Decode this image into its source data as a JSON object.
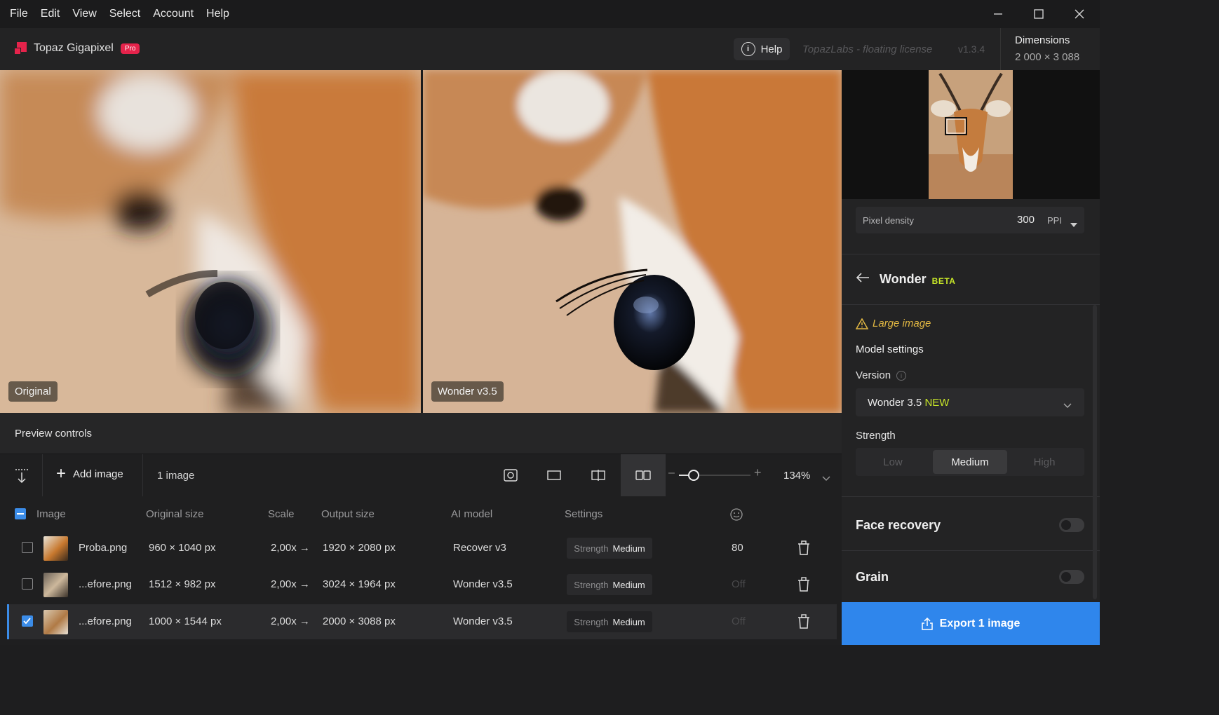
{
  "menu": [
    "File",
    "Edit",
    "View",
    "Select",
    "Account",
    "Help"
  ],
  "app": {
    "name": "Topaz Gigapixel",
    "badge": "Pro",
    "help_label": "Help",
    "license": "TopazLabs - floating license",
    "version": "v1.3.4"
  },
  "dimensions": {
    "label": "Dimensions",
    "value": "2 000 × 3 088"
  },
  "preview": {
    "left_tag": "Original",
    "right_tag": "Wonder v3.5",
    "controls_label": "Preview controls"
  },
  "toolbar": {
    "add_image": "Add image",
    "image_count": "1 image",
    "zoom": "134%",
    "zoom_level": 0.2
  },
  "table": {
    "headers": {
      "image": "Image",
      "original": "Original size",
      "scale": "Scale",
      "output": "Output size",
      "model": "AI model",
      "settings": "Settings"
    },
    "rows": [
      {
        "name": "Proba.png",
        "original": "960 × 1040 px",
        "scale": "2,00x →",
        "output": "1920 × 2080 px",
        "model": "Recover v3",
        "strength_key": "Strength",
        "strength": "Medium",
        "face": "80",
        "checked": false
      },
      {
        "name": "...efore.png",
        "original": "1512 × 982 px",
        "scale": "2,00x →",
        "output": "3024 × 1964 px",
        "model": "Wonder v3.5",
        "strength_key": "Strength",
        "strength": "Medium",
        "face": "Off",
        "checked": false
      },
      {
        "name": "...efore.png",
        "original": "1000 × 1544 px",
        "scale": "2,00x →",
        "output": "2000 × 3088 px",
        "model": "Wonder v3.5",
        "strength_key": "Strength",
        "strength": "Medium",
        "face": "Off",
        "checked": true
      }
    ]
  },
  "sidebar": {
    "pixel_density": {
      "label": "Pixel density",
      "value": "300",
      "unit": "PPI"
    },
    "model_title": "Wonder",
    "model_badge": "BETA",
    "warning": "Large image",
    "model_settings": "Model settings",
    "version_label": "Version",
    "version_value": "Wonder 3.5",
    "version_new": "NEW",
    "strength_label": "Strength",
    "strength_options": [
      "Low",
      "Medium",
      "High"
    ],
    "strength_selected": "Medium",
    "face_recovery": "Face recovery",
    "grain": "Grain",
    "export": "Export 1 image"
  },
  "colors": {
    "accent": "#2f86ec",
    "brand": "#e5234b",
    "beta": "#c7e628",
    "warning": "#e2b843"
  }
}
